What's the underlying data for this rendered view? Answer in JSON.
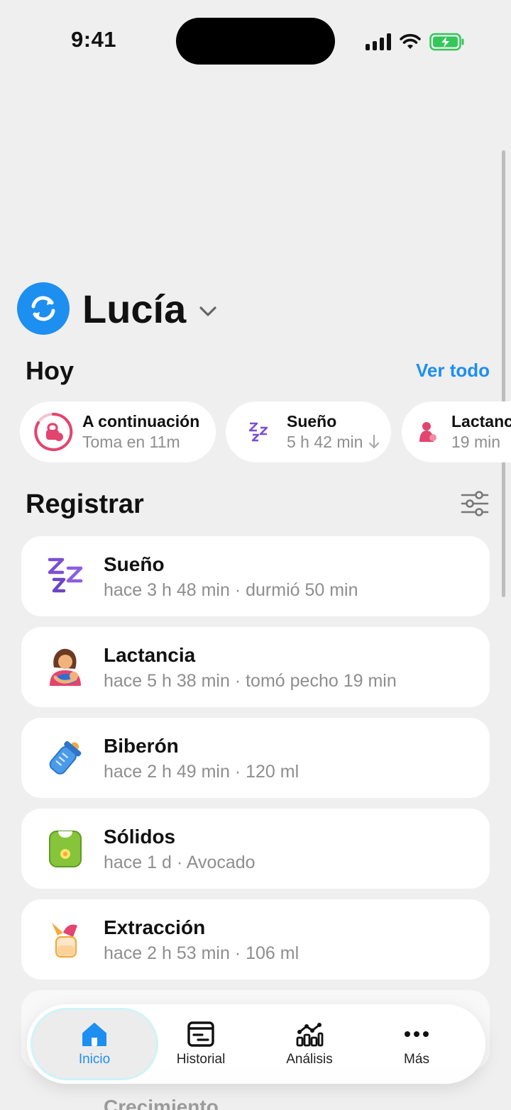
{
  "status_bar": {
    "time": "9:41"
  },
  "profile": {
    "name": "Lucía"
  },
  "today": {
    "title": "Hoy",
    "view_all": "Ver todo",
    "chips": [
      {
        "title": "A continuación",
        "subtitle": "Toma en 11m",
        "icon": "bottle-timer-icon"
      },
      {
        "title": "Sueño",
        "subtitle": "5 h 42 min",
        "icon": "sleep-zzz-icon"
      },
      {
        "title": "Lactancia",
        "subtitle": "19 min",
        "icon": "breastfeeding-icon"
      }
    ]
  },
  "register": {
    "title": "Registrar",
    "items": [
      {
        "title": "Sueño",
        "subtitle": "hace 3 h 48 min · durmió 50 min",
        "icon": "sleep-zzz-icon"
      },
      {
        "title": "Lactancia",
        "subtitle": "hace 5 h 38 min · tomó pecho 19 min",
        "icon": "breastfeeding-icon"
      },
      {
        "title": "Biberón",
        "subtitle": "hace 2 h 49 min · 120 ml",
        "icon": "baby-bottle-icon"
      },
      {
        "title": "Sólidos",
        "subtitle": "hace 1 d · Avocado",
        "icon": "bib-icon"
      },
      {
        "title": "Extracción",
        "subtitle": "hace 2 h 53 min · 106 ml",
        "icon": "breast-pump-icon"
      }
    ],
    "partial_item": "Crecimiento"
  },
  "tabbar": {
    "tabs": [
      {
        "label": "Inicio",
        "icon": "home-icon",
        "active": true
      },
      {
        "label": "Historial",
        "icon": "history-icon"
      },
      {
        "label": "Análisis",
        "icon": "chart-icon"
      },
      {
        "label": "Más",
        "icon": "more-icon"
      }
    ]
  },
  "colors": {
    "accent": "#1d8ff0",
    "sleep": "#7b4fd6",
    "feeding": "#e2456f",
    "background": "#efefef"
  }
}
